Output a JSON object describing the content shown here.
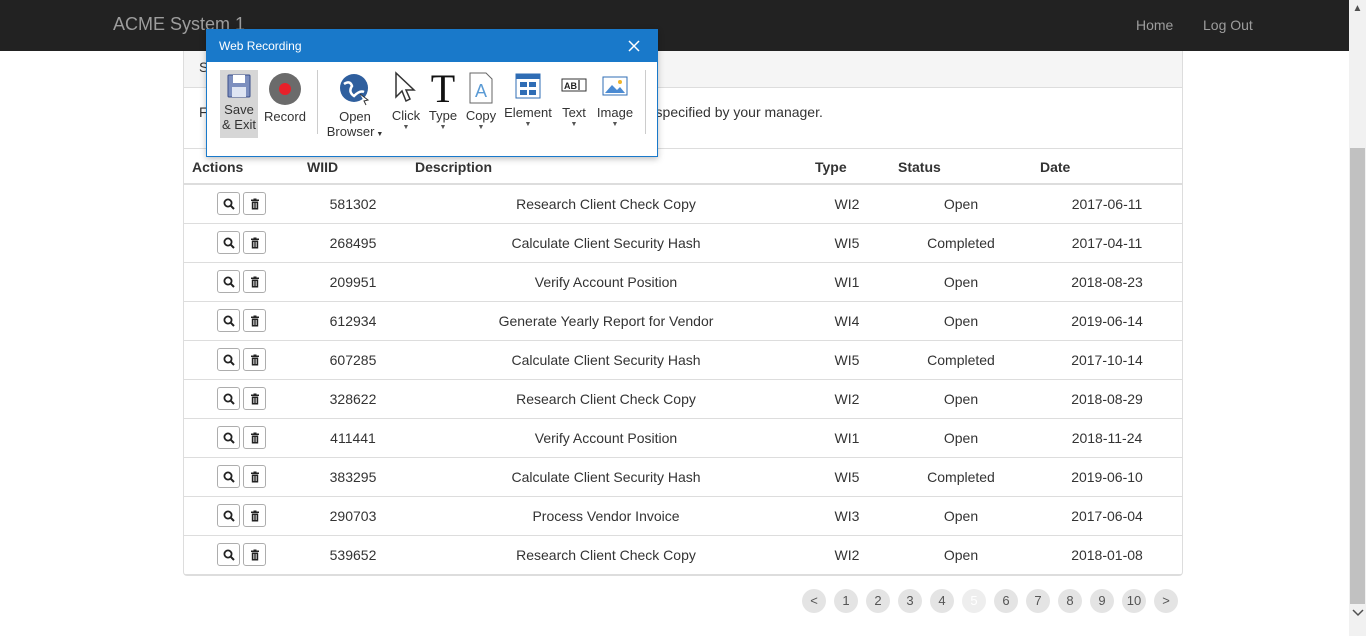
{
  "app": {
    "title": "ACME System 1"
  },
  "nav": {
    "home": "Home",
    "logout": "Log Out"
  },
  "panel": {
    "heading": "S",
    "body_left": "F",
    "body_right": "r specified by your manager."
  },
  "table": {
    "headers": [
      "Actions",
      "WIID",
      "Description",
      "Type",
      "Status",
      "Date"
    ],
    "rows": [
      {
        "wiid": "581302",
        "desc": "Research Client Check Copy",
        "type": "WI2",
        "status": "Open",
        "date": "2017-06-11"
      },
      {
        "wiid": "268495",
        "desc": "Calculate Client Security Hash",
        "type": "WI5",
        "status": "Completed",
        "date": "2017-04-11"
      },
      {
        "wiid": "209951",
        "desc": "Verify Account Position",
        "type": "WI1",
        "status": "Open",
        "date": "2018-08-23"
      },
      {
        "wiid": "612934",
        "desc": "Generate Yearly Report for Vendor",
        "type": "WI4",
        "status": "Open",
        "date": "2019-06-14"
      },
      {
        "wiid": "607285",
        "desc": "Calculate Client Security Hash",
        "type": "WI5",
        "status": "Completed",
        "date": "2017-10-14"
      },
      {
        "wiid": "328622",
        "desc": "Research Client Check Copy",
        "type": "WI2",
        "status": "Open",
        "date": "2018-08-29"
      },
      {
        "wiid": "411441",
        "desc": "Verify Account Position",
        "type": "WI1",
        "status": "Open",
        "date": "2018-11-24"
      },
      {
        "wiid": "383295",
        "desc": "Calculate Client Security Hash",
        "type": "WI5",
        "status": "Completed",
        "date": "2019-06-10"
      },
      {
        "wiid": "290703",
        "desc": "Process Vendor Invoice",
        "type": "WI3",
        "status": "Open",
        "date": "2017-06-04"
      },
      {
        "wiid": "539652",
        "desc": "Research Client Check Copy",
        "type": "WI2",
        "status": "Open",
        "date": "2018-01-08"
      }
    ]
  },
  "pagination": {
    "prev": "<",
    "pages": [
      "1",
      "2",
      "3",
      "4",
      "5",
      "6",
      "7",
      "8",
      "9",
      "10"
    ],
    "next": ">",
    "active": "5"
  },
  "recorder": {
    "title": "Web Recording",
    "tools": {
      "save": [
        "Save",
        "& Exit"
      ],
      "record": "Record",
      "open": [
        "Open",
        "Browser"
      ],
      "click": "Click",
      "type": "Type",
      "copy": "Copy",
      "element": "Element",
      "text": "Text",
      "image": "Image"
    }
  },
  "colors": {
    "navbar": "#222222",
    "dialog_accent": "#1979ca",
    "record_red": "#e8202a"
  }
}
